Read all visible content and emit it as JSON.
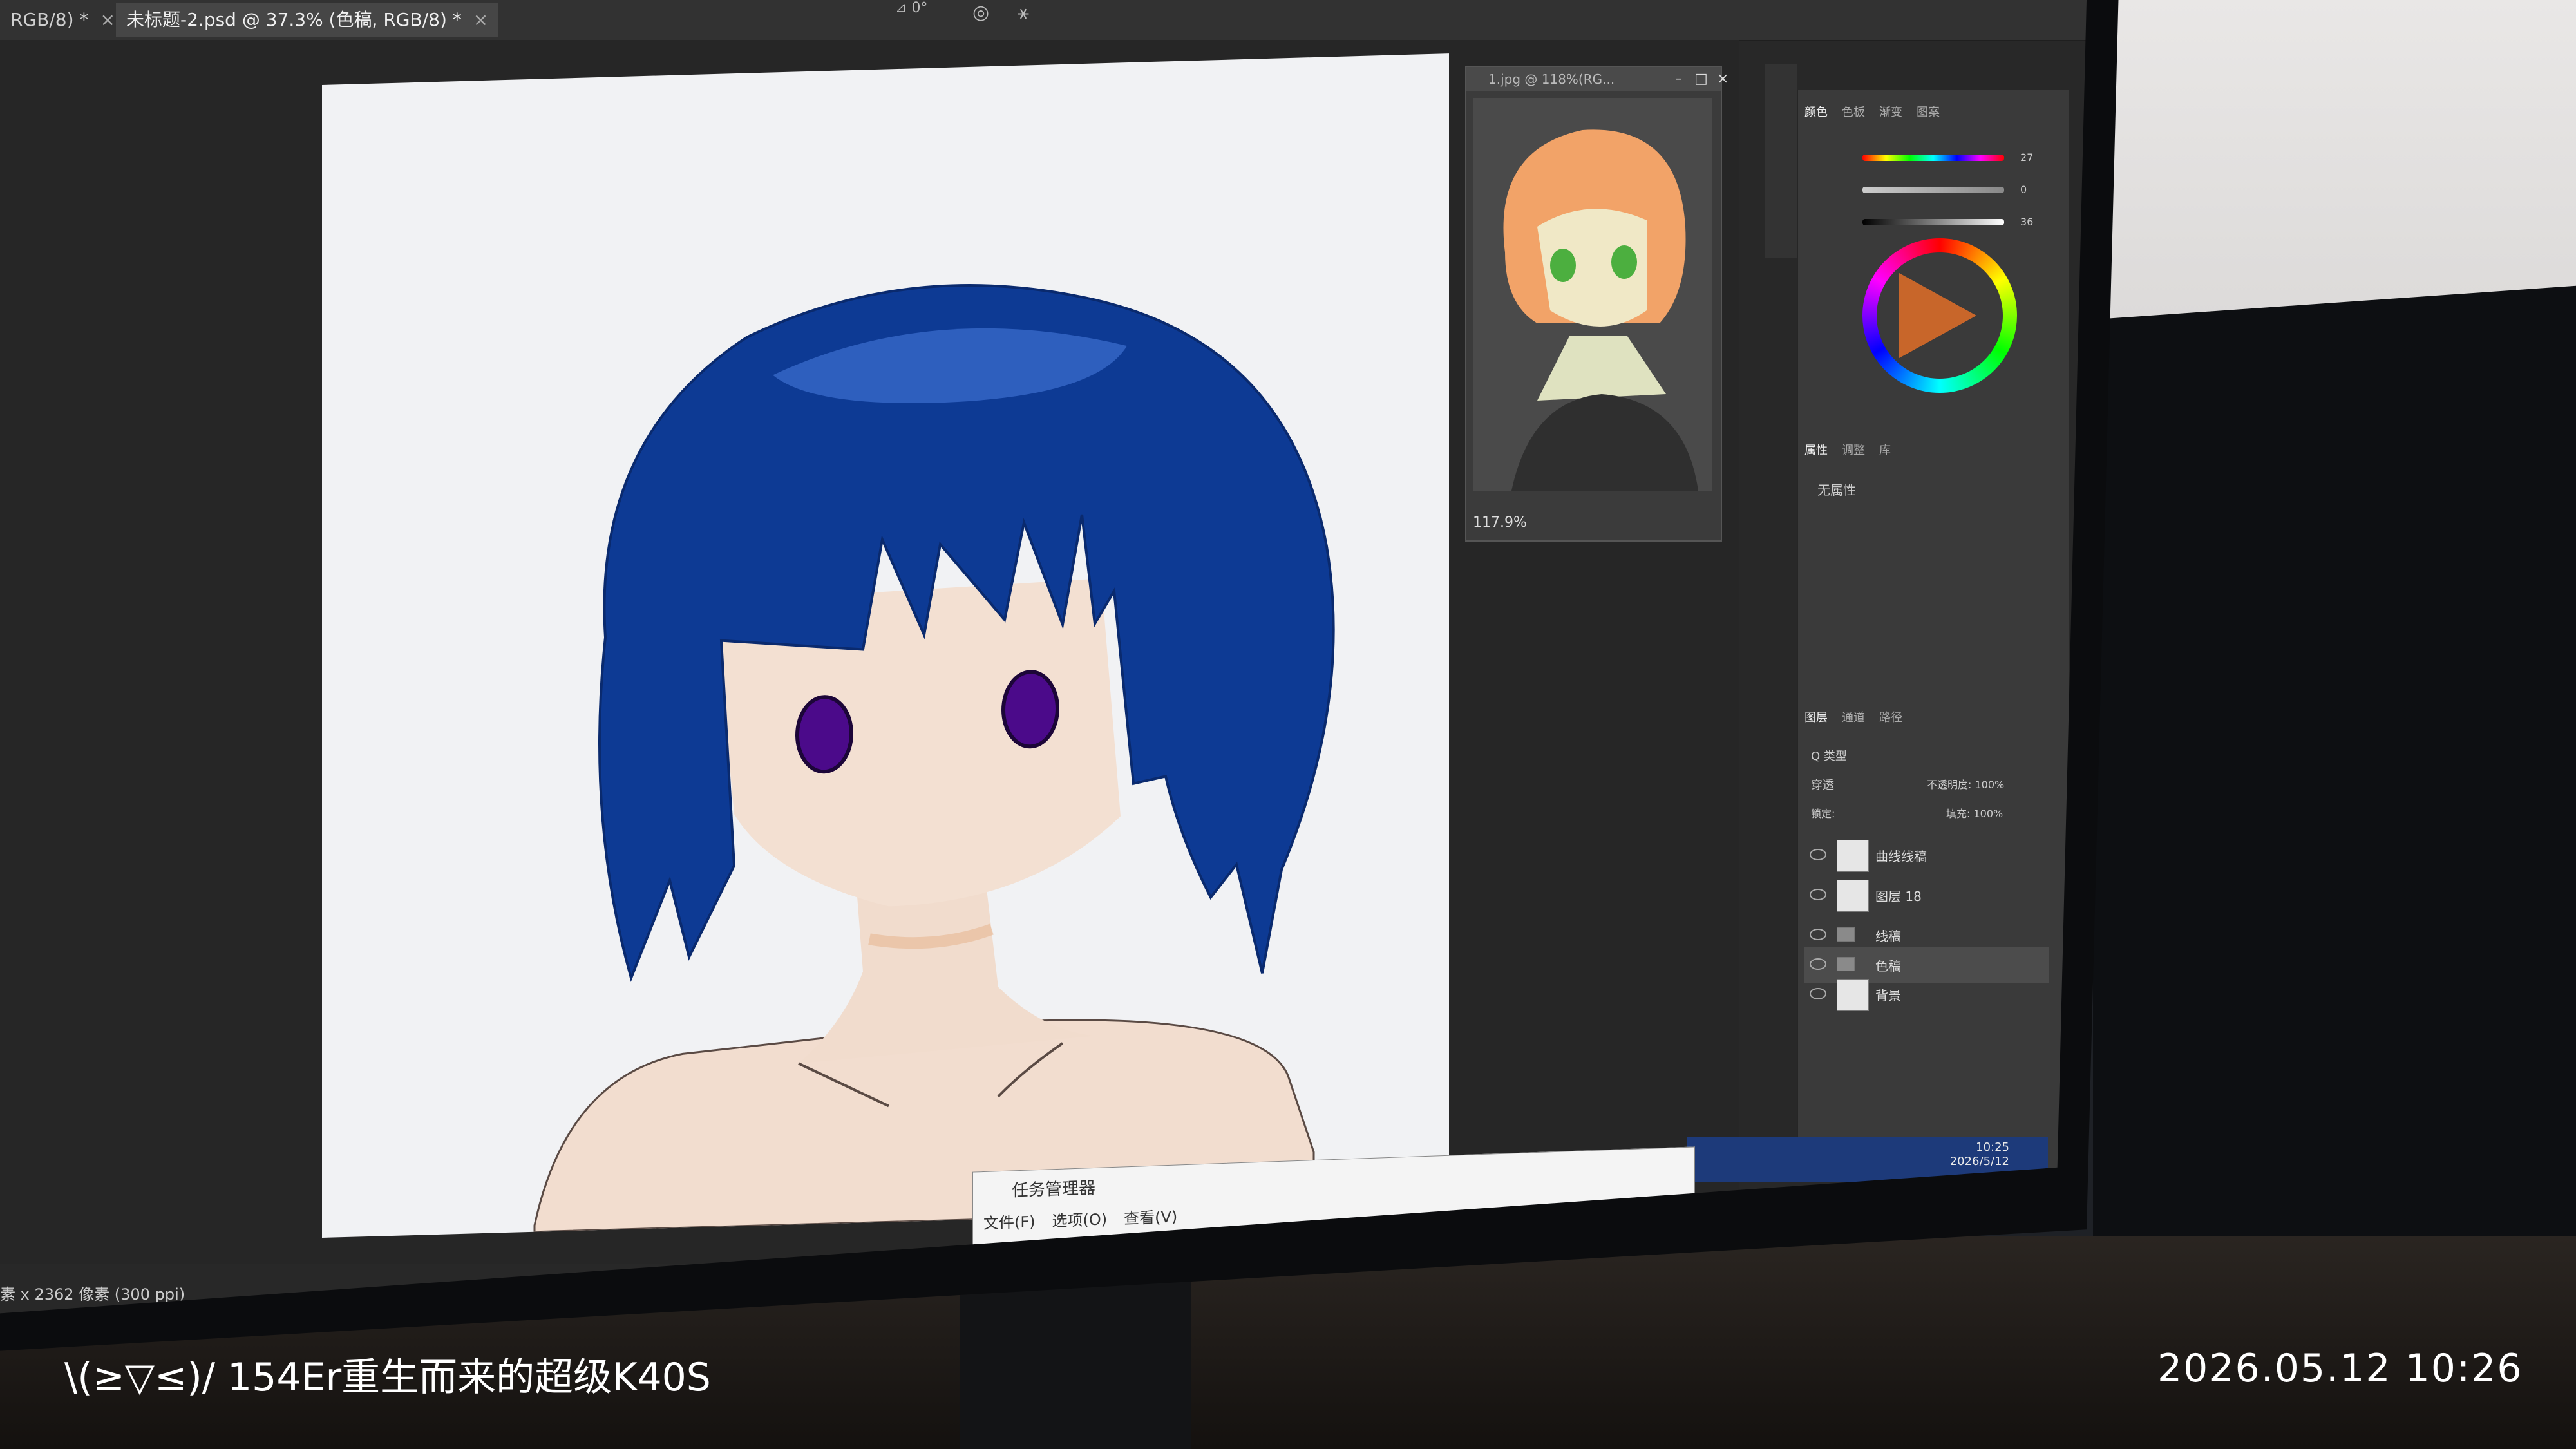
{
  "photo_watermark": {
    "left_text": "\\(≥▽≤)/ 154Er重生而来的超级K40S",
    "datetime": "2026.05.12  10:26"
  },
  "photoshop": {
    "tabs": [
      {
        "label": "RGB/8) *",
        "active": false
      },
      {
        "label": "未标题-2.psd @ 37.3% (色稿, RGB/8) *",
        "active": true
      }
    ],
    "options_bar": {
      "angle": "0°"
    },
    "reference_window": {
      "title": "1.jpg @ 118%(RG...",
      "zoom": "117.9%"
    },
    "color_panel": {
      "tabs": [
        "颜色",
        "色板",
        "渐变",
        "图案"
      ],
      "r": "27",
      "g": "0",
      "b": "36"
    },
    "properties_panel": {
      "tabs": [
        "属性",
        "调整",
        "库"
      ],
      "empty_text": "无属性"
    },
    "layers_panel": {
      "tabs": [
        "图层",
        "通道",
        "路径"
      ],
      "filter": "Q 类型",
      "blend_mode": "穿透",
      "opacity_label": "不透明度: 100%",
      "lock_label": "锁定:",
      "fill_label": "填充: 100%",
      "layers": [
        {
          "name": "曲线线稿",
          "kind": "layer",
          "selected": false
        },
        {
          "name": "图层 18",
          "kind": "layer",
          "selected": false
        },
        {
          "name": "线稿",
          "kind": "group",
          "selected": false
        },
        {
          "name": "色稿",
          "kind": "group",
          "selected": true
        },
        {
          "name": "背景",
          "kind": "layer",
          "selected": false
        }
      ]
    },
    "status_bar": "素 x 2362 像素 (300 ppi)"
  },
  "task_manager": {
    "title": "任务管理器",
    "menu": [
      "文件(F)",
      "选项(O)",
      "查看(V)"
    ]
  },
  "windows_taskbar": {
    "time": "10:25",
    "date": "2026/5/12"
  },
  "colors": {
    "hair": "#0d3a94",
    "skin": "#f2ddcf",
    "eyes": "#4b0a8a",
    "ps_dark": "#282828"
  }
}
